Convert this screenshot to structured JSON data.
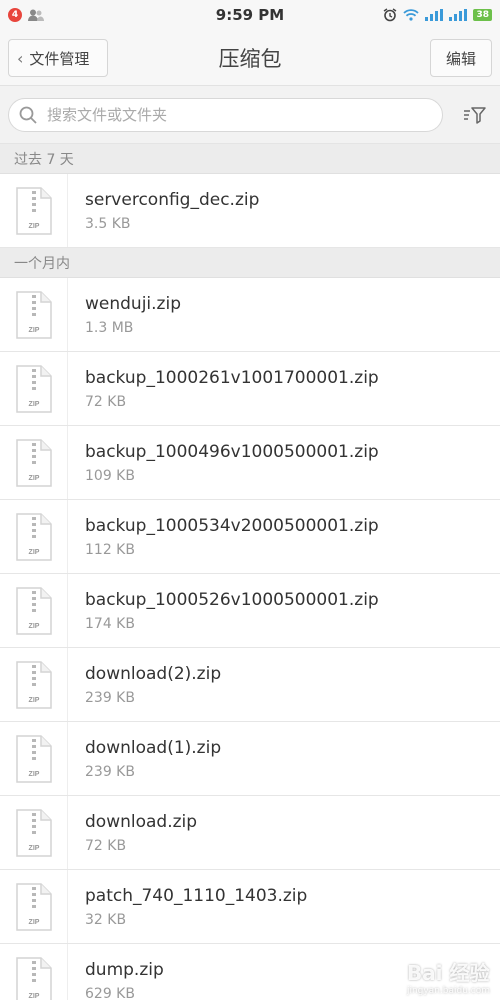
{
  "status_bar": {
    "time": "9:59 PM",
    "notification_count": "4",
    "battery": "38"
  },
  "header": {
    "back_label": "文件管理",
    "title": "压缩包",
    "edit_label": "编辑"
  },
  "search": {
    "placeholder": "搜索文件或文件夹"
  },
  "sections": [
    {
      "label": "过去 7 天",
      "files": [
        {
          "name": "serverconfig_dec.zip",
          "size": "3.5 KB"
        }
      ]
    },
    {
      "label": "一个月内",
      "files": [
        {
          "name": "wenduji.zip",
          "size": "1.3 MB"
        },
        {
          "name": "backup_1000261v1001700001.zip",
          "size": "72 KB"
        },
        {
          "name": "backup_1000496v1000500001.zip",
          "size": "109 KB"
        },
        {
          "name": "backup_1000534v2000500001.zip",
          "size": "112 KB"
        },
        {
          "name": "backup_1000526v1000500001.zip",
          "size": "174 KB"
        },
        {
          "name": "download(2).zip",
          "size": "239 KB"
        },
        {
          "name": "download(1).zip",
          "size": "239 KB"
        },
        {
          "name": "download.zip",
          "size": "72 KB"
        },
        {
          "name": "patch_740_1110_1403.zip",
          "size": "32 KB"
        },
        {
          "name": "dump.zip",
          "size": "629 KB"
        }
      ]
    }
  ],
  "file_icon_label": "ZIP",
  "watermark": {
    "text": "Bai 经验",
    "sub": "jingyan.baidu.com"
  }
}
